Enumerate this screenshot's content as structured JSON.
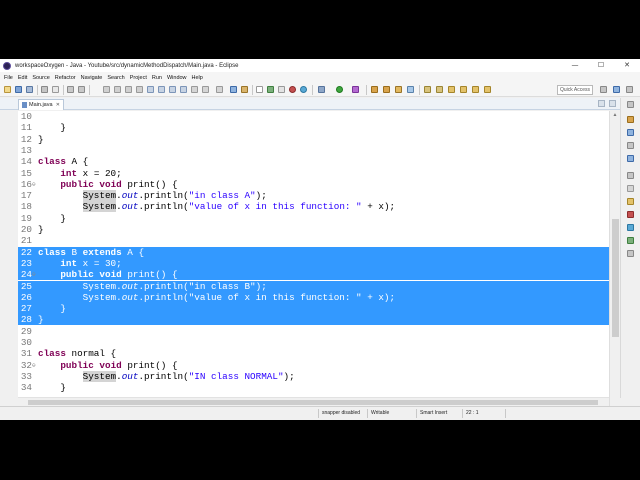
{
  "window": {
    "title": "workspaceOxygen - Java - Youtube/src/dynamicMethodDispatch/Main.java - Eclipse",
    "minimize": "—",
    "maximize": "☐",
    "close": "✕"
  },
  "menu": [
    "File",
    "Edit",
    "Source",
    "Refactor",
    "Navigate",
    "Search",
    "Project",
    "Run",
    "Window",
    "Help"
  ],
  "toolbar": {
    "quick_access": "Quick Access"
  },
  "editor_tab": {
    "label": "Main.java",
    "close": "✕"
  },
  "code_lines": [
    {
      "num": "10",
      "text": ""
    },
    {
      "num": "11",
      "text": "    }"
    },
    {
      "num": "12",
      "text": "}"
    },
    {
      "num": "13",
      "text": ""
    },
    {
      "num": "14",
      "text": "class A {"
    },
    {
      "num": "15",
      "text": "    int x = 20;"
    },
    {
      "num": "16",
      "text": "    public void print() {"
    },
    {
      "num": "17",
      "text": "        System.out.println(\"in class A\");"
    },
    {
      "num": "18",
      "text": "        System.out.println(\"value of x in this function: \" + x);"
    },
    {
      "num": "19",
      "text": "    }"
    },
    {
      "num": "20",
      "text": "}"
    },
    {
      "num": "21",
      "text": ""
    },
    {
      "num": "22",
      "text": "class B extends A {"
    },
    {
      "num": "23",
      "text": "    int x = 30;"
    },
    {
      "num": "24",
      "text": "    public void print() {"
    },
    {
      "num": "25",
      "text": "        System.out.println(\"in class B\");"
    },
    {
      "num": "26",
      "text": "        System.out.println(\"value of x in this function: \" + x);"
    },
    {
      "num": "27",
      "text": "    }"
    },
    {
      "num": "28",
      "text": "}"
    },
    {
      "num": "29",
      "text": ""
    },
    {
      "num": "30",
      "text": ""
    },
    {
      "num": "31",
      "text": "class normal {"
    },
    {
      "num": "32",
      "text": "    public void print() {"
    },
    {
      "num": "33",
      "text": "        System.out.println(\"IN class NORMAL\");"
    },
    {
      "num": "34",
      "text": "    }"
    }
  ],
  "selection": {
    "first_line": "22",
    "last_line": "28"
  },
  "statusbar": {
    "snapper": "snapper disabled",
    "writable": "Writable",
    "insert_mode": "Smart Insert",
    "position": "22 : 1"
  },
  "colors": {
    "selection": "#3399ff",
    "keyword": "#7f0055",
    "string": "#2a00ff",
    "field": "#0000c0"
  }
}
